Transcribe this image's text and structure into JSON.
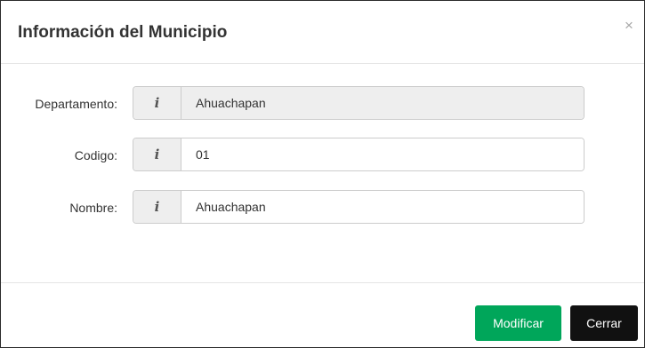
{
  "modal": {
    "title": "Información del Municipio",
    "close_symbol": "×"
  },
  "form": {
    "addon_icon": "info-icon",
    "addon_glyph": "i",
    "fields": [
      {
        "label": "Departamento:",
        "value": "Ahuachapan",
        "readonly": true
      },
      {
        "label": "Codigo:",
        "value": "01",
        "readonly": false
      },
      {
        "label": "Nombre:",
        "value": "Ahuachapan",
        "readonly": false
      }
    ]
  },
  "footer": {
    "modify_label": "Modificar",
    "close_label": "Cerrar"
  },
  "colors": {
    "modify_button": "#00a65a",
    "close_button": "#111111",
    "addon_background": "#eeeeee"
  }
}
